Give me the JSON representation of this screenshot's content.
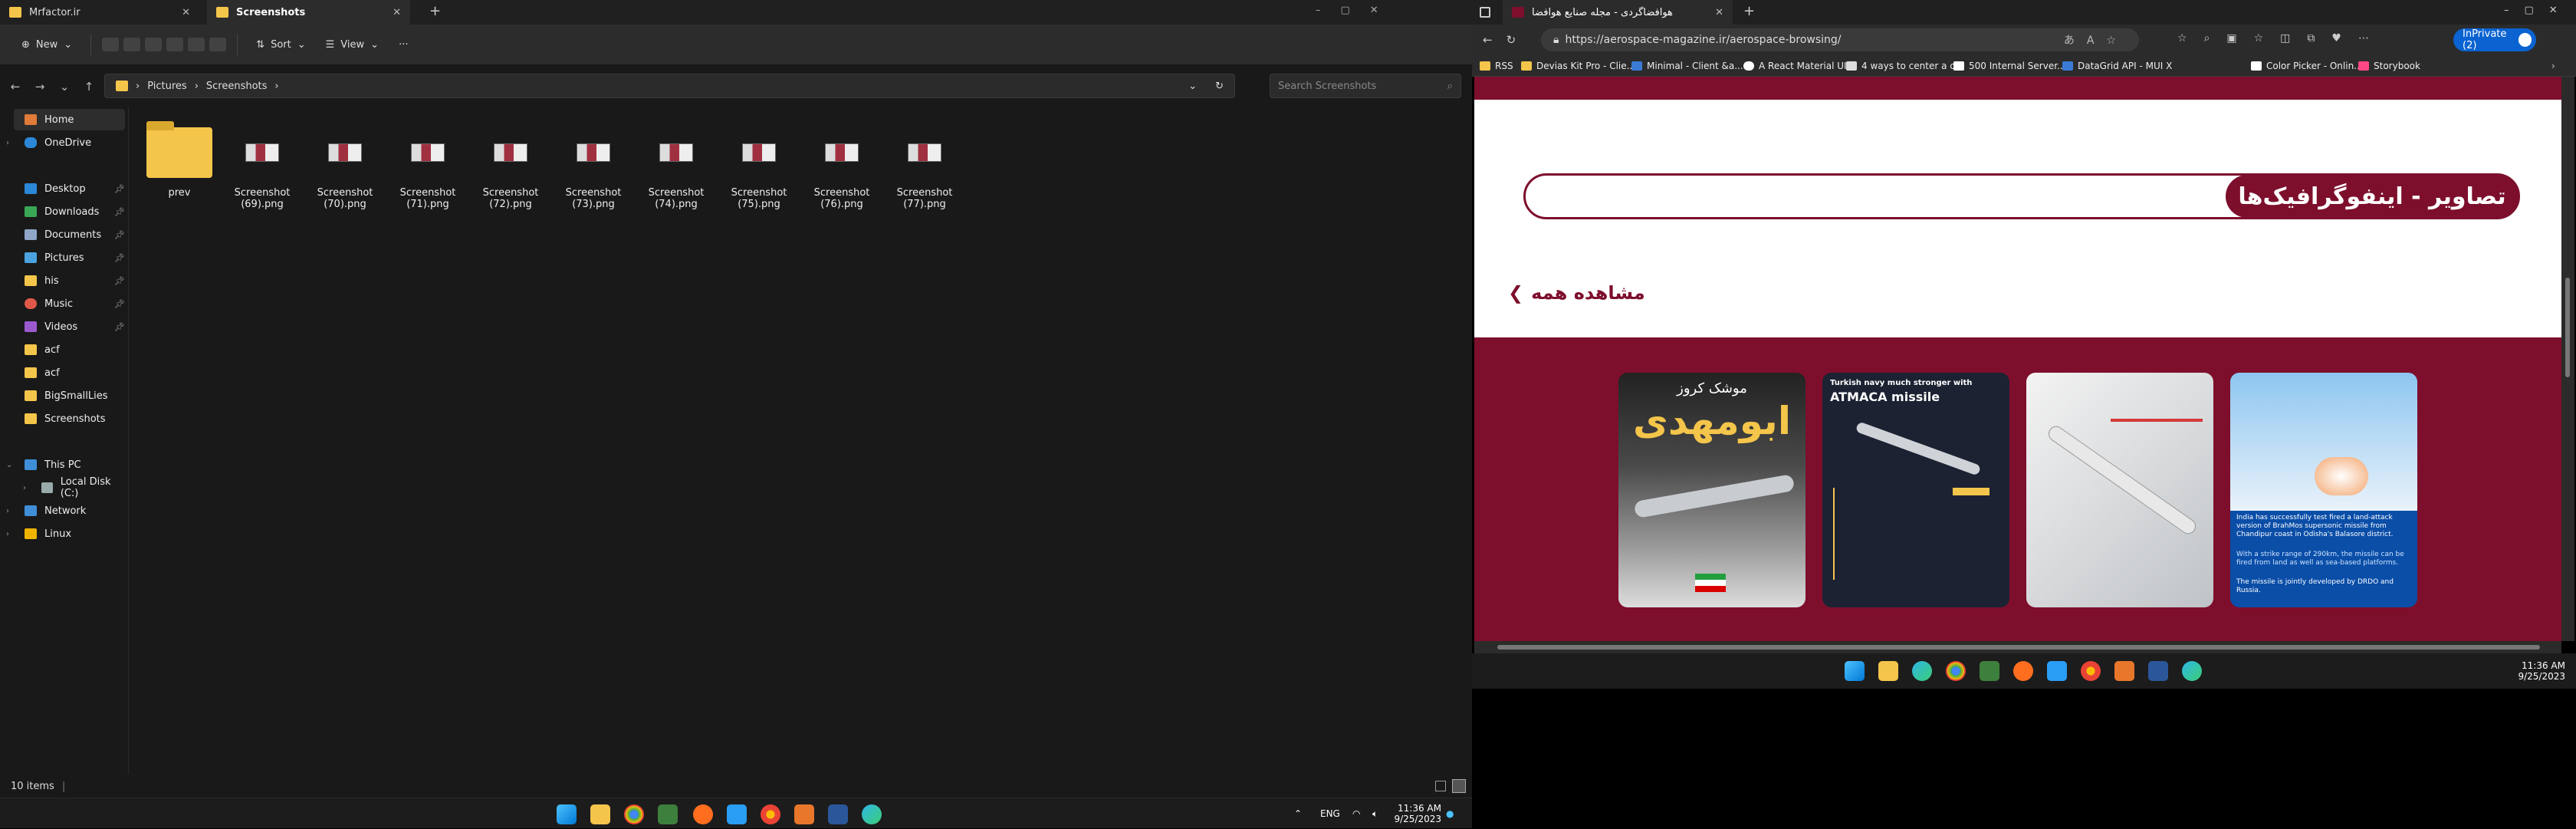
{
  "explorer": {
    "tabs": [
      {
        "title": "Mrfactor.ir"
      },
      {
        "title": "Screenshots"
      }
    ],
    "toolbar": {
      "new_label": "New",
      "sort_label": "Sort",
      "view_label": "View"
    },
    "breadcrumb": [
      "Pictures",
      "Screenshots"
    ],
    "search_placeholder": "Search Screenshots",
    "sidebar": {
      "home": "Home",
      "onedrive": "OneDrive",
      "quick": [
        "Desktop",
        "Downloads",
        "Documents",
        "Pictures",
        "his",
        "Music",
        "Videos",
        "acf",
        "acf",
        "BigSmallLies",
        "Screenshots"
      ],
      "this_pc": "This PC",
      "local_disk": "Local Disk (C:)",
      "network": "Network",
      "linux": "Linux"
    },
    "files": [
      {
        "name": "prev",
        "type": "folder"
      },
      {
        "name": "Screenshot (69).png",
        "type": "image"
      },
      {
        "name": "Screenshot (70).png",
        "type": "image"
      },
      {
        "name": "Screenshot (71).png",
        "type": "image"
      },
      {
        "name": "Screenshot (72).png",
        "type": "image"
      },
      {
        "name": "Screenshot (73).png",
        "type": "image"
      },
      {
        "name": "Screenshot (74).png",
        "type": "image"
      },
      {
        "name": "Screenshot (75).png",
        "type": "image"
      },
      {
        "name": "Screenshot (76).png",
        "type": "image"
      },
      {
        "name": "Screenshot (77).png",
        "type": "image"
      }
    ],
    "status": "10 items",
    "taskbar": {
      "lang": "ENG",
      "time": "11:36 AM",
      "date": "9/25/2023"
    }
  },
  "edge": {
    "tab_title": "هوافضاگردی - مجله صنایع هوافضا",
    "url": "https://aerospace-magazine.ir/aerospace-browsing/",
    "inprivate_label": "InPrivate (2)",
    "bookmarks": [
      "RSS",
      "Devias Kit Pro - Clie...",
      "Minimal - Client &a...",
      "A React Material UI...",
      "4 ways to center a c...",
      "500 Internal Server...",
      "DataGrid API - MUI X",
      "Color Picker - Onlin...",
      "Storybook"
    ],
    "page": {
      "section_title": "تصاویر - اینفوگرافیک‌ها",
      "view_all": "مشاهده همه",
      "cards": [
        {
          "headline": "Turkish navy much stronger with",
          "headline_em": "ATMACA missile"
        },
        {
          "headline_top": "موشک کروز",
          "headline_big": "ابومهدی"
        },
        {
          "body": "India has successfully test fired a land-attack version of BrahMos supersonic missile from Chandipur coast in Odisha's Balasore district.",
          "body2": "With a strike range of 290km, the missile can be fired from land as well as sea-based platforms.",
          "body3": "The missile is jointly developed by DRDO and Russia."
        }
      ]
    },
    "taskbar": {
      "time": "11:36 AM",
      "date": "9/25/2023"
    }
  },
  "colors": {
    "brand": "#7d0f2c",
    "accent": "#0b63d1"
  }
}
